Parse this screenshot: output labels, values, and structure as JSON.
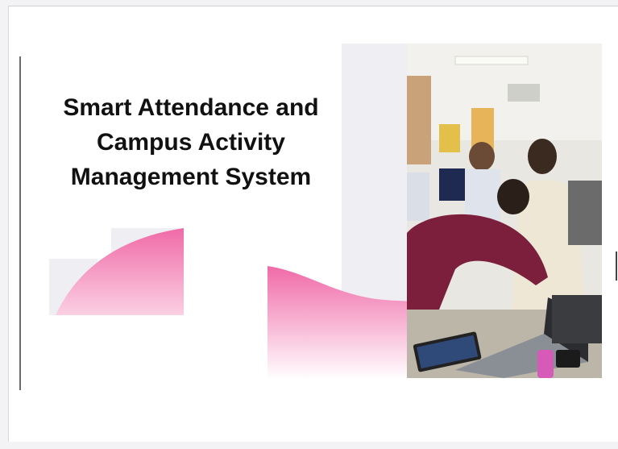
{
  "slide": {
    "title_line1": "Smart Attendance and",
    "title_line2": "Campus Activity",
    "title_line3": "Management System"
  },
  "colors": {
    "pink": "#f06aa8",
    "pink_light": "#f9c4dc",
    "panel": "#efeff3",
    "text": "#111111"
  },
  "photo": {
    "icon": "photo-icon"
  }
}
